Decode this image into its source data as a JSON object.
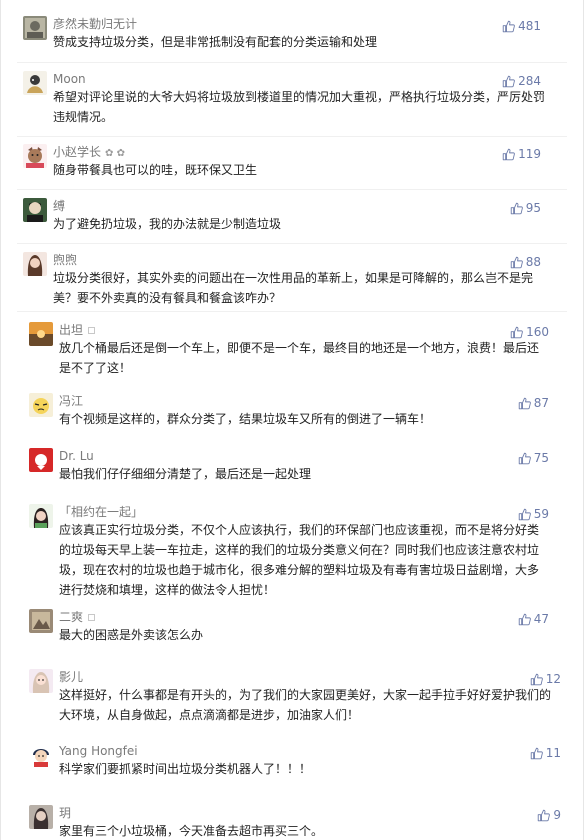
{
  "comments": [
    {
      "user": "彦然未勤归无计",
      "badge": "",
      "likes": "481",
      "text": "赞成支持垃圾分类，但是非常抵制没有配套的分类运输和处理"
    },
    {
      "user": "Moon",
      "badge": "",
      "likes": "284",
      "text": "希望对评论里说的大爷大妈将垃圾放到楼道里的情况加大重视，严格执行垃圾分类，严厉处罚违规情况。"
    },
    {
      "user": "小赵学长",
      "badge": "✿ ✿",
      "likes": "119",
      "text": "随身带餐具也可以的哇，既环保又卫生"
    },
    {
      "user": "缚",
      "badge": "",
      "likes": "95",
      "text": "为了避免扔垃圾，我的办法就是少制造垃圾"
    },
    {
      "user": "煦煦",
      "badge": "",
      "likes": "88",
      "text": "垃圾分类很好，其实外卖的问题出在一次性用品的革新上，如果是可降解的，那么岂不是完美？要不外卖真的没有餐具和餐盒该咋办？"
    },
    {
      "user": "出坦",
      "badge": "",
      "likes": "160",
      "text": "放几个桶最后还是倒一个车上，即便不是一个车，最终目的地还是一个地方，浪费！最后还是不了了这！"
    },
    {
      "user": "冯江",
      "badge": "",
      "likes": "87",
      "text": "有个视频是这样的，群众分类了，结果垃圾车又所有的倒进了一辆车！"
    },
    {
      "user": "Dr. Lu",
      "badge": "",
      "likes": "75",
      "text": "最怕我们仔仔细细分清楚了，最后还是一起处理"
    },
    {
      "user": "「相约在一起」",
      "badge": "",
      "likes": "59",
      "text": "应该真正实行垃圾分类，不仅个人应该执行，我们的环保部门也应该重视，而不是将分好类的垃圾每天早上装一车拉走，这样的我们的垃圾分类意义何在？同时我们也应该注意农村垃圾，现在农村的垃圾也趋于城市化，很多难分解的塑料垃圾及有毒有害垃圾日益剧增，大多进行焚烧和填埋，这样的做法令人担忧！"
    },
    {
      "user": "二爽",
      "badge": "",
      "likes": "47",
      "text": "最大的困惑是外卖该怎么办"
    },
    {
      "user": "影儿",
      "badge": "",
      "likes": "12",
      "text": "这样挺好，什么事都是有开头的，为了我们的大家园更美好，大家一起手拉手好好爱护我们的大环境，从自身做起，点点滴滴都是进步，加油家人们！"
    },
    {
      "user": "Yang Hongfei",
      "badge": "",
      "likes": "11",
      "text": "科学家们要抓紧时间出垃圾分类机器人了！！！"
    },
    {
      "user": "玥",
      "badge": "",
      "likes": "9",
      "text": "家里有三个小垃圾桶，今天准备去超市再买三个。"
    }
  ],
  "colors": {
    "username": "#7a7a7a",
    "text": "#222222",
    "like": "#6b7aa8"
  },
  "icons": {
    "like": "thumbs-up-icon"
  }
}
